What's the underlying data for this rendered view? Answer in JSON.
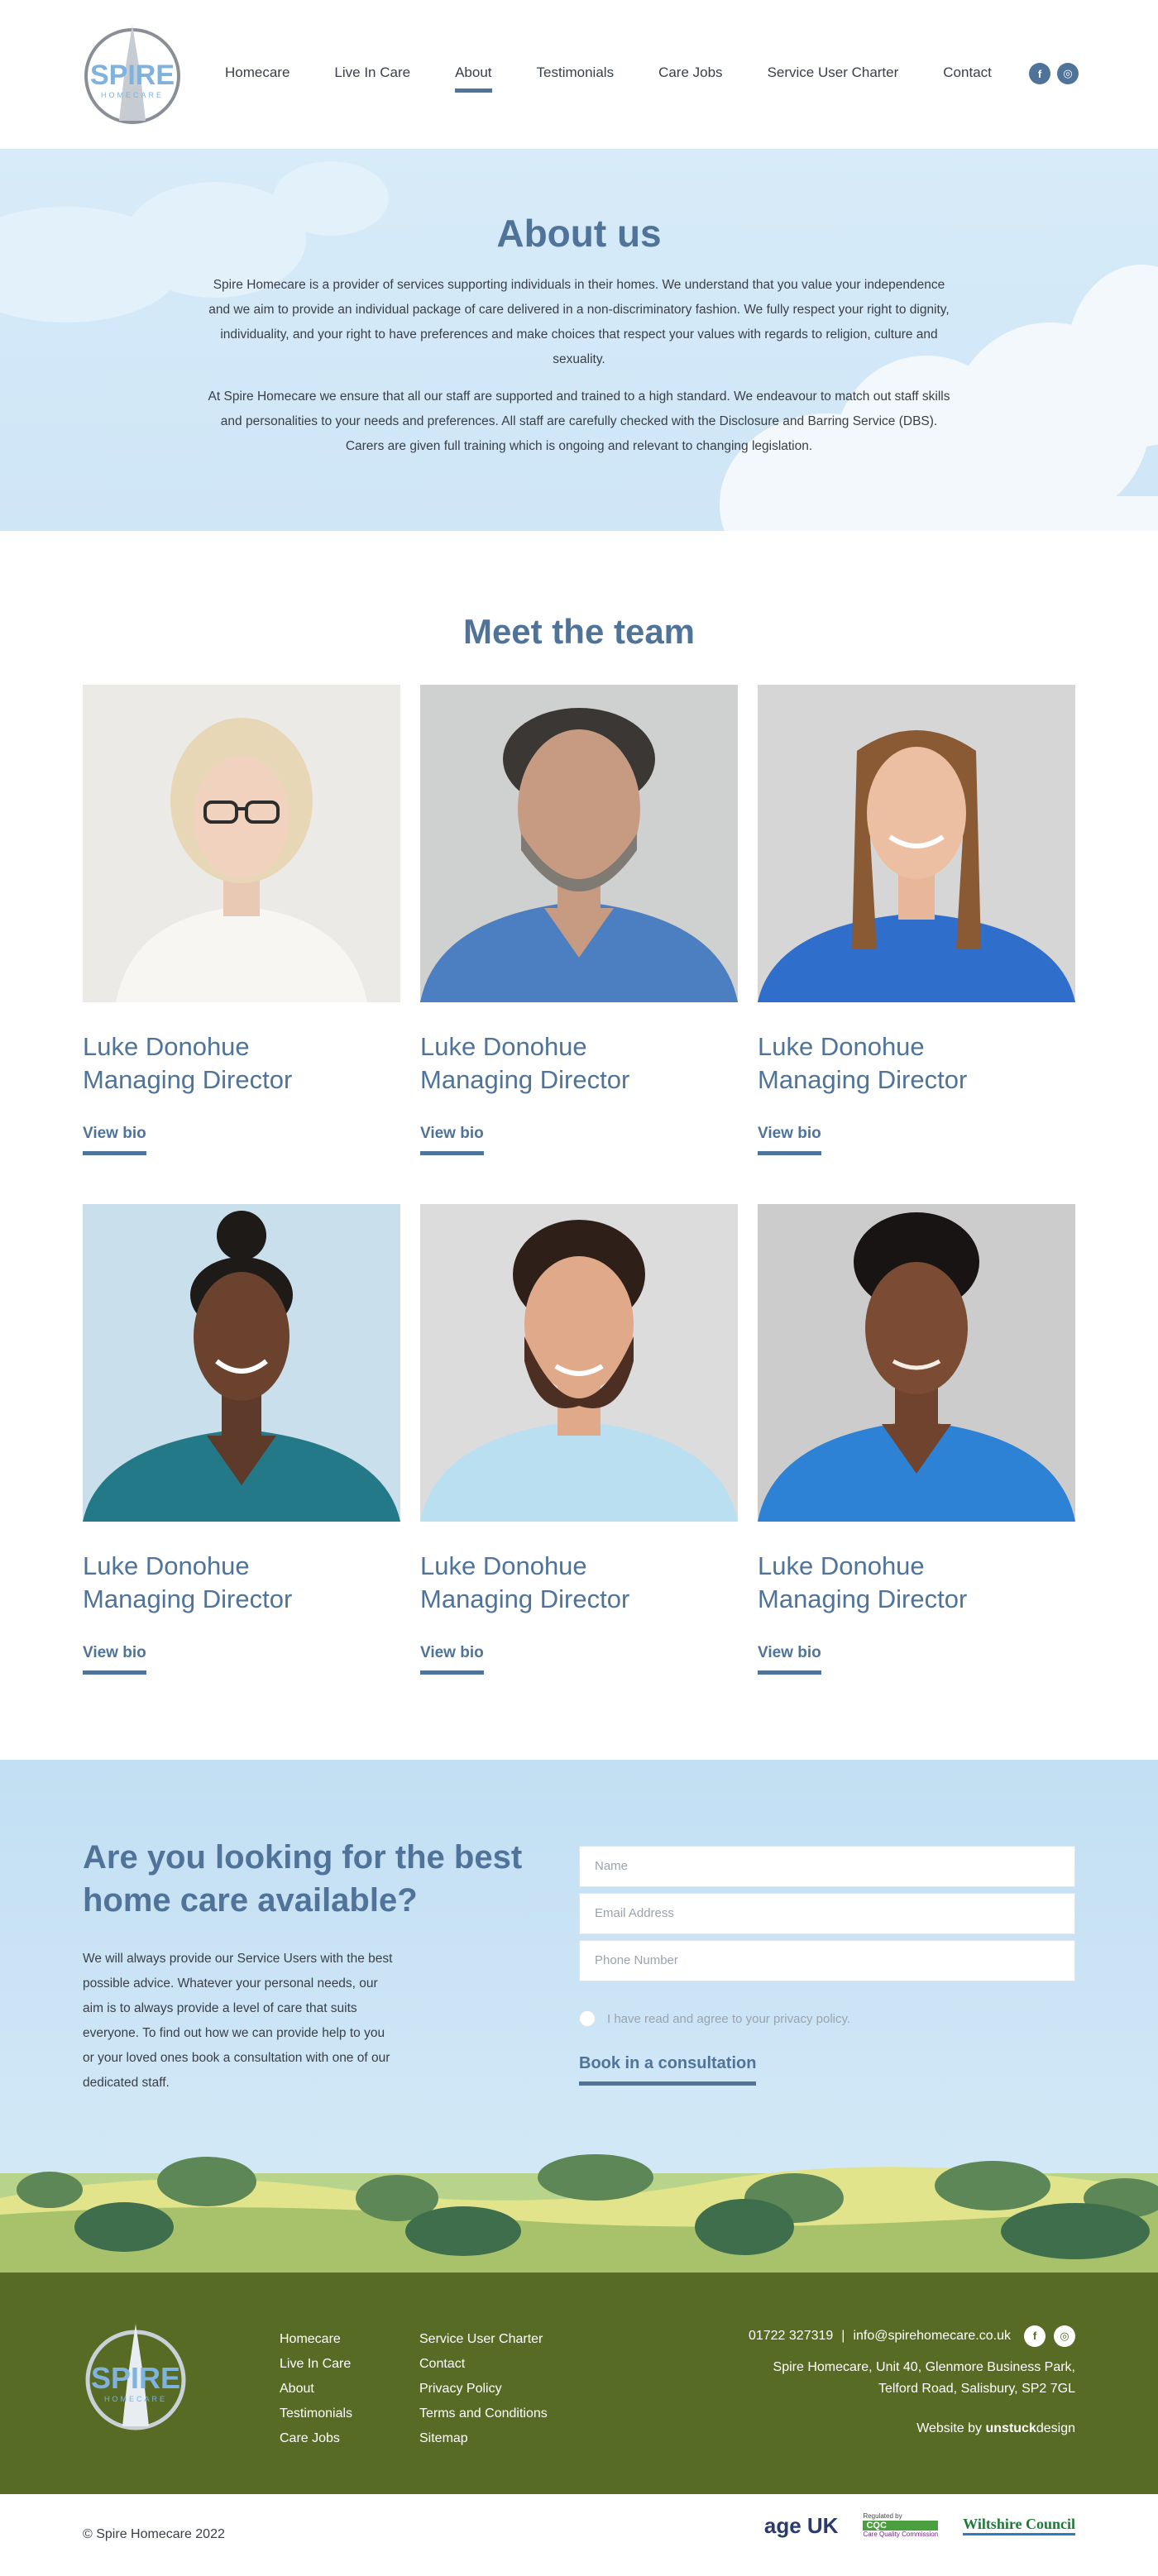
{
  "brand": {
    "name": "SPIRE",
    "sub": "HOMECARE",
    "colors": {
      "primary": "#4f7399",
      "footer": "#576b24",
      "sky": "#cfe6f7"
    }
  },
  "nav": {
    "items": [
      {
        "label": "Homecare"
      },
      {
        "label": "Live In Care"
      },
      {
        "label": "About"
      },
      {
        "label": "Testimonials"
      },
      {
        "label": "Care Jobs"
      },
      {
        "label": "Service User Charter"
      },
      {
        "label": "Contact"
      }
    ],
    "active": "About",
    "social": {
      "facebook": "f",
      "instagram": "◎"
    }
  },
  "about": {
    "title": "About us",
    "p1": "Spire Homecare is a provider of services supporting individuals in their homes. We understand that you value your independence and we aim to provide an individual package of care delivered in a non-discriminatory fashion. We fully respect your right to dignity, individuality, and your right to have preferences and make choices that respect your values with regards to religion, culture and sexuality.",
    "p2": "At Spire Homecare we ensure that all our staff are supported and trained to a high standard. We endeavour to match out staff skills and personalities to your needs and preferences. All staff are carefully checked with the Disclosure and Barring Service (DBS). Carers are given full training which is ongoing and relevant to changing legislation."
  },
  "team": {
    "title": "Meet the team",
    "members": [
      {
        "name": "Luke Donohue",
        "role": "Managing Director",
        "link": "View bio"
      },
      {
        "name": "Luke Donohue",
        "role": "Managing Director",
        "link": "View bio"
      },
      {
        "name": "Luke Donohue",
        "role": "Managing Director",
        "link": "View bio"
      },
      {
        "name": "Luke Donohue",
        "role": "Managing Director",
        "link": "View bio"
      },
      {
        "name": "Luke Donohue",
        "role": "Managing Director",
        "link": "View bio"
      },
      {
        "name": "Luke Donohue",
        "role": "Managing Director",
        "link": "View bio"
      }
    ]
  },
  "contact": {
    "heading": "Are you looking for the best home care available?",
    "text": "We will always provide our Service Users with the best possible advice. Whatever your personal needs, our aim is to always provide a level of care that suits everyone. To find out how we can provide help to you or your loved ones book a consultation with one of our dedicated staff.",
    "name_placeholder": "Name",
    "email_placeholder": "Email Address",
    "phone_placeholder": "Phone Number",
    "consent": "I have read and agree to your privacy policy.",
    "cta": "Book in a consultation"
  },
  "footer": {
    "col1": [
      "Homecare",
      "Live In Care",
      "About",
      "Testimonials",
      "Care Jobs"
    ],
    "col2": [
      "Service User Charter",
      "Contact",
      "Privacy Policy",
      "Terms and Conditions",
      "Sitemap"
    ],
    "phone": "01722 327319",
    "separator": "|",
    "email": "info@spirehomecare.co.uk",
    "address1": "Spire Homecare, Unit 40, Glenmore Business Park,",
    "address2": "Telford Road, Salisbury, SP2 7GL",
    "credit_prefix": "Website by",
    "credit_brand": "unstuck",
    "credit_suffix": "design",
    "copyright": "© Spire Homecare 2022",
    "partners": {
      "ageuk": "age UK",
      "cqc_top": "Regulated by",
      "cqc_logo": "CQC",
      "cqc_name": "Care Quality Commission",
      "wilts": "Wiltshire Council"
    }
  }
}
